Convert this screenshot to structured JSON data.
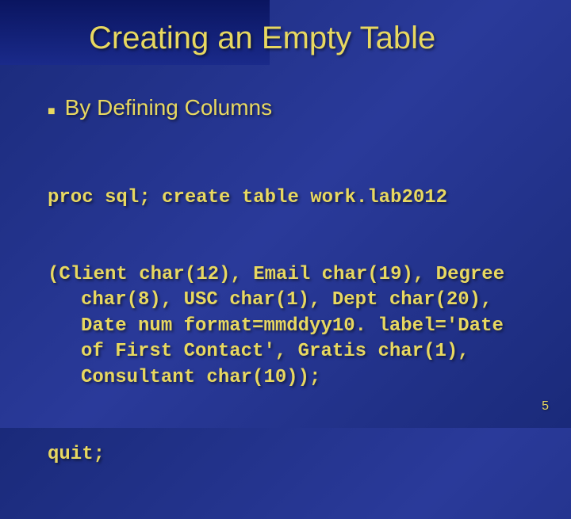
{
  "slide": {
    "title": "Creating an Empty Table",
    "bullet_label": "By Defining Columns",
    "code_line1": "proc sql; create table work.lab2012",
    "code_line2": "(Client char(12), Email char(19), Degree char(8), USC char(1), Dept char(20), Date num format=mmddyy10. label='Date of First Contact', Gratis char(1), Consultant char(10));",
    "code_line3": "quit;",
    "page_number": "5"
  }
}
